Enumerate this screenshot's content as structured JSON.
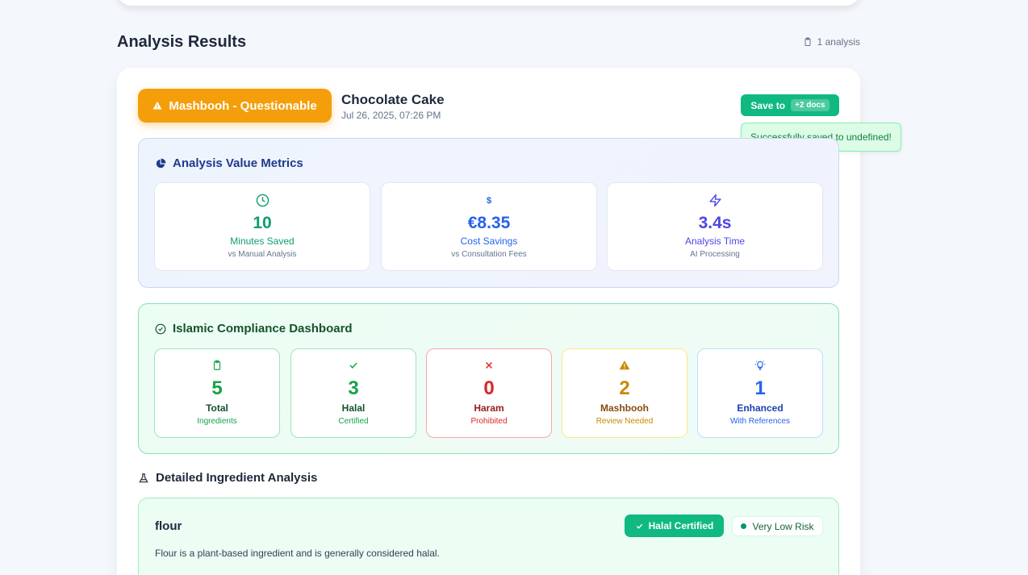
{
  "header": {
    "title": "Analysis Results",
    "count_text": "1 analysis"
  },
  "result": {
    "status_label": "Mashbooh - Questionable",
    "product_name": "Chocolate Cake",
    "date": "Jul 26, 2025, 07:26 PM",
    "save_label": "Save to",
    "docs_chip": "+2 docs",
    "toast": "Successfully saved to undefined!"
  },
  "metrics": {
    "title": "Analysis Value Metrics",
    "items": [
      {
        "icon": "clock-icon",
        "value": "10",
        "label": "Minutes Saved",
        "sub": "vs Manual Analysis",
        "color": "#0f9d6b"
      },
      {
        "icon": "dollar-icon",
        "value": "€8.35",
        "label": "Cost Savings",
        "sub": "vs Consultation Fees",
        "color": "#2563eb"
      },
      {
        "icon": "lightning-icon",
        "value": "3.4s",
        "label": "Analysis Time",
        "sub": "AI Processing",
        "color": "#4f46e5"
      }
    ]
  },
  "compliance": {
    "title": "Islamic Compliance Dashboard",
    "items": [
      {
        "icon": "clipboard-icon",
        "value": "5",
        "label": "Total",
        "sub": "Ingredients",
        "color": "#16a34a"
      },
      {
        "icon": "check-icon",
        "value": "3",
        "label": "Halal",
        "sub": "Certified",
        "color": "#16a34a"
      },
      {
        "icon": "x-icon",
        "value": "0",
        "label": "Haram",
        "sub": "Prohibited",
        "color": "#dc2626"
      },
      {
        "icon": "warning-icon",
        "value": "2",
        "label": "Mashbooh",
        "sub": "Review Needed",
        "color": "#ca8a04"
      },
      {
        "icon": "lightbulb-icon",
        "value": "1",
        "label": "Enhanced",
        "sub": "With References",
        "color": "#2563eb"
      }
    ]
  },
  "details": {
    "title": "Detailed Ingredient Analysis",
    "ingredients": [
      {
        "name": "flour",
        "badge": "Halal Certified",
        "risk": "Very Low Risk",
        "description": "Flour is a plant-based ingredient and is generally considered halal."
      }
    ]
  }
}
